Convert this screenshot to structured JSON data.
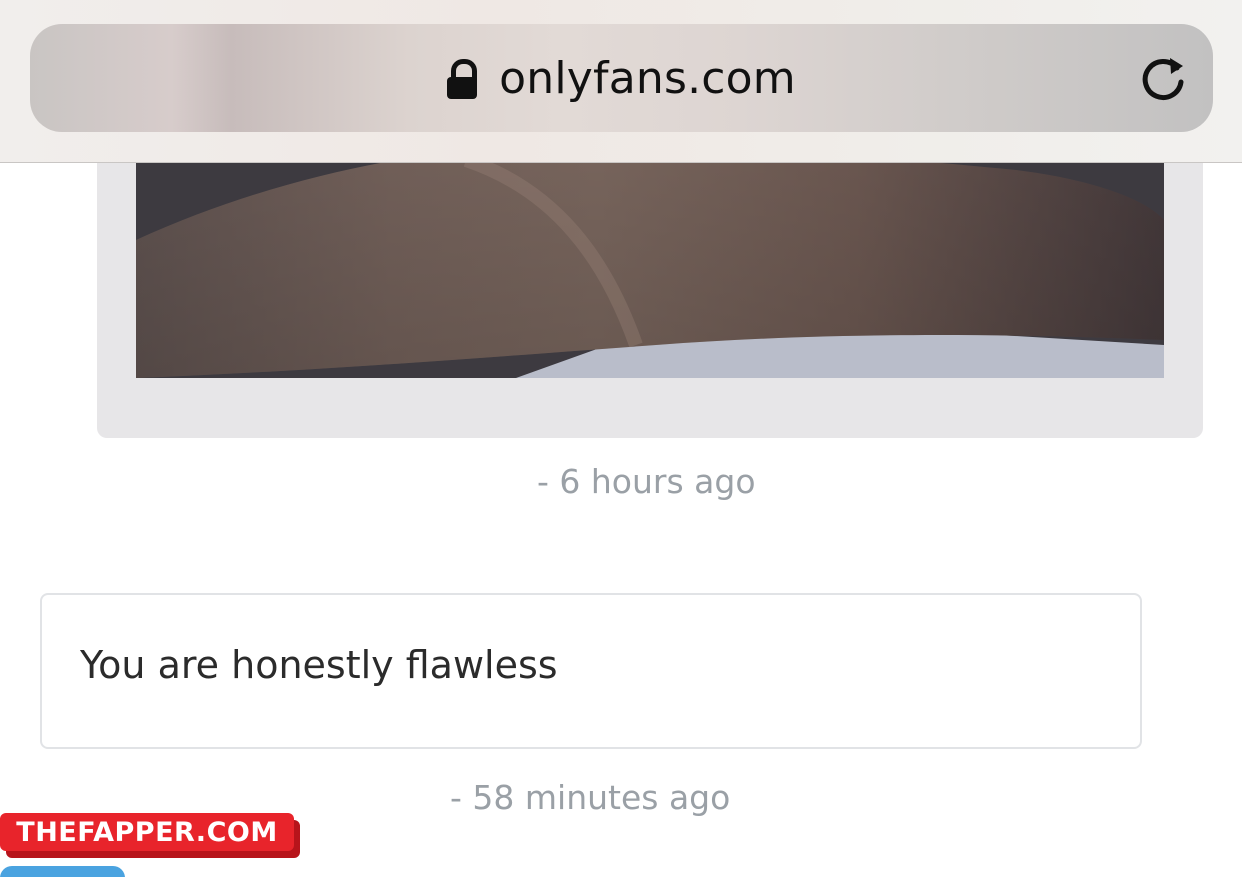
{
  "browser": {
    "url": "onlyfans.com",
    "lock_icon": "lock-icon",
    "reload_icon": "reload-icon"
  },
  "feed": {
    "post_timestamp": "-  6 hours ago",
    "comment": {
      "text": "You are honestly flawless",
      "timestamp": "-  58 minutes ago"
    }
  },
  "watermark": {
    "text": "THEFAPPER.COM"
  },
  "colors": {
    "timestamp": "#9aa0a6",
    "comment_border": "#e1e3e6",
    "card_background": "#e7e6e8",
    "watermark_red": "#e8242b"
  }
}
